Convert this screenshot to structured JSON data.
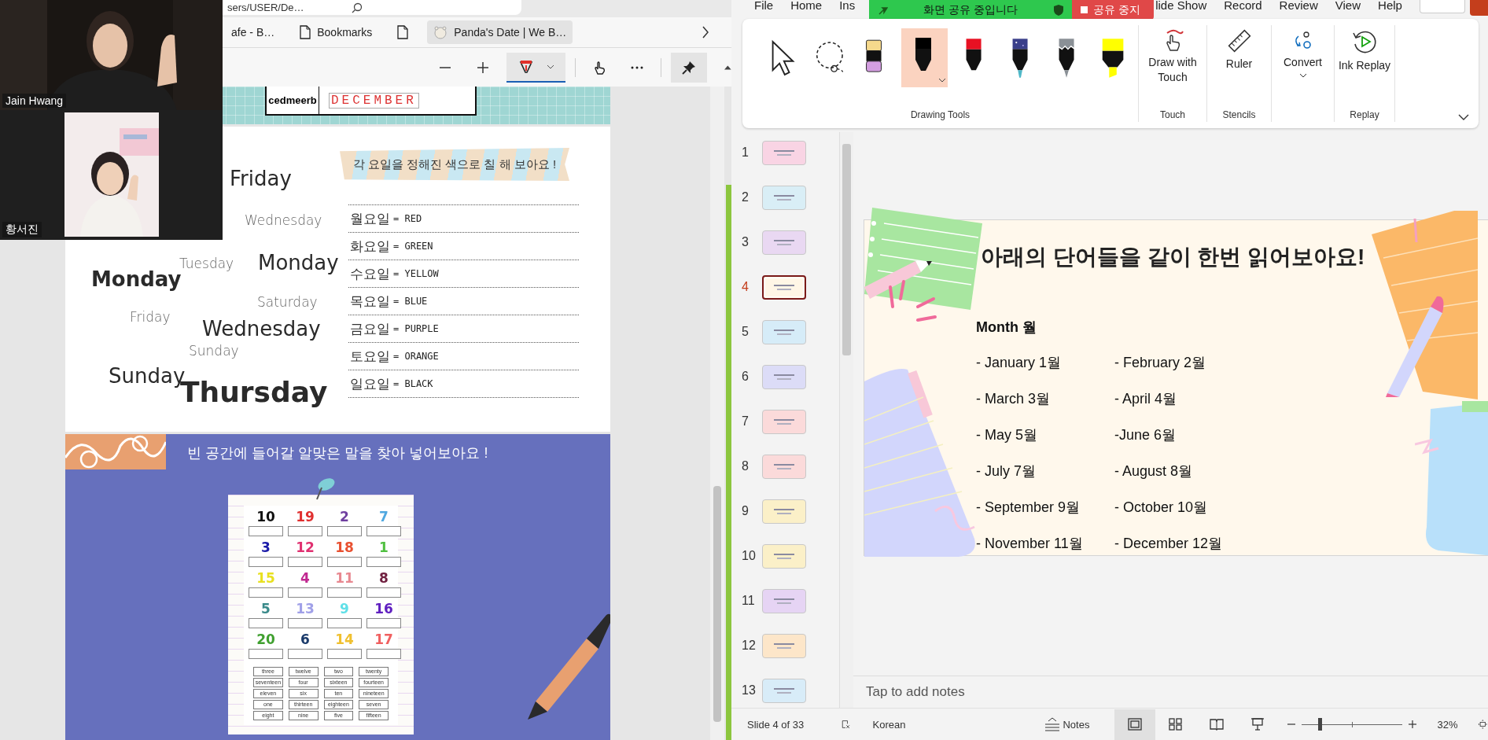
{
  "video_call": {
    "participants": [
      {
        "name": "Jain Hwang",
        "kind": "picture"
      },
      {
        "name": "황서진",
        "kind": "picture"
      }
    ]
  },
  "browser": {
    "address": "sers/USER/De…",
    "bookmarks": [
      {
        "kind": "text",
        "label": "afe - B…",
        "selected": false
      },
      {
        "kind": "page",
        "label": "Bookmarks",
        "selected": false
      },
      {
        "kind": "page-only",
        "selected": false
      },
      {
        "kind": "favicon",
        "label": "Panda's Date | We B…",
        "selected": true
      }
    ],
    "pdf_tools": [
      {
        "kind": "zoom-out",
        "selected": false
      },
      {
        "kind": "zoom-in",
        "selected": false
      },
      {
        "kind": "draw",
        "selected": true
      },
      {
        "kind": "touch",
        "selected": false
      },
      {
        "kind": "more",
        "selected": false
      },
      {
        "kind": "pin",
        "selected": true
      }
    ]
  },
  "worksheet": {
    "answer_row": {
      "scrambled": "cedmeerb",
      "answer": "DECEMBER"
    },
    "days_activity": {
      "banner": "각 요일을 정해진 색으로 칠 해 보아요 !",
      "word_cloud": [
        {
          "text": "Friday",
          "kind": "large"
        },
        {
          "text": "Wednesday",
          "kind": "small"
        },
        {
          "text": "Tuesday",
          "kind": "small"
        },
        {
          "text": "Monday",
          "kind": "large"
        },
        {
          "text": "Monday",
          "kind": "bold"
        },
        {
          "text": "Saturday",
          "kind": "small"
        },
        {
          "text": "Friday",
          "kind": "small"
        },
        {
          "text": "Wednesday",
          "kind": "large"
        },
        {
          "text": "Sunday",
          "kind": "small"
        },
        {
          "text": "Sunday",
          "kind": "large"
        },
        {
          "text": "Thursday",
          "kind": "huge"
        }
      ],
      "color_key": [
        {
          "day": "월요일",
          "value": "= RED"
        },
        {
          "day": "화요일",
          "value": "= GREEN"
        },
        {
          "day": "수요일",
          "value": "= YELLOW"
        },
        {
          "day": "목요일",
          "value": "= BLUE"
        },
        {
          "day": "금요일",
          "value": "= PURPLE"
        },
        {
          "day": "토요일",
          "value": "= ORANGE"
        },
        {
          "day": "일요일",
          "value": "= BLACK"
        }
      ]
    },
    "numbers_activity": {
      "instruction": "빈 공간에 들어갈 알맞은 말을 찾아 넣어보아요 !",
      "numbers": [
        {
          "text": "10",
          "color": "#111111"
        },
        {
          "text": "19",
          "color": "#e03030"
        },
        {
          "text": "2",
          "color": "#7040a0"
        },
        {
          "text": "7",
          "color": "#50a8e0"
        },
        {
          "text": "3",
          "color": "#1a1aa8"
        },
        {
          "text": "12",
          "color": "#e03070"
        },
        {
          "text": "18",
          "color": "#e85030"
        },
        {
          "text": "1",
          "color": "#50c040"
        },
        {
          "text": "15",
          "color": "#e8e020"
        },
        {
          "text": "4",
          "color": "#c02890"
        },
        {
          "text": "11",
          "color": "#e88890"
        },
        {
          "text": "8",
          "color": "#702040"
        },
        {
          "text": "5",
          "color": "#3a8a8a"
        },
        {
          "text": "13",
          "color": "#a0a0e8"
        },
        {
          "text": "9",
          "color": "#60e0e8"
        },
        {
          "text": "16",
          "color": "#6020c0"
        },
        {
          "text": "20",
          "color": "#40a030"
        },
        {
          "text": "6",
          "color": "#1a3a6a"
        },
        {
          "text": "14",
          "color": "#f0c030"
        },
        {
          "text": "17",
          "color": "#f06060"
        }
      ],
      "word_bank": [
        "three",
        "twelve",
        "two",
        "twenty",
        "seventeen",
        "four",
        "sixteen",
        "fourteen",
        "eleven",
        "six",
        "ten",
        "nineteen",
        "one",
        "thirteen",
        "eighteen",
        "seven",
        "eight",
        "nine",
        "five",
        "fifteen"
      ]
    }
  },
  "powerpoint": {
    "menu": [
      "File",
      "Home",
      "Ins",
      "lide Show",
      "Record",
      "Review",
      "View",
      "Help"
    ],
    "share_banner": {
      "status": "화면 공유 중입니다",
      "stop_button": "공유 중지"
    },
    "ribbon": {
      "drawing_tools": {
        "label": "Drawing Tools",
        "tools": [
          {
            "kind": "select",
            "selected": false
          },
          {
            "kind": "lasso",
            "selected": false
          },
          {
            "kind": "eraser",
            "selected": false
          },
          {
            "kind": "pen",
            "color": "#000000",
            "selected": true
          },
          {
            "kind": "pen",
            "color": "#e81123",
            "selected": false
          },
          {
            "kind": "galaxy",
            "selected": false
          },
          {
            "kind": "pencil",
            "selected": false
          },
          {
            "kind": "highlighter",
            "color": "#ffff00",
            "selected": false
          }
        ]
      },
      "groups": [
        {
          "label": "Touch",
          "button": {
            "kind": "touch",
            "label": "Draw with Touch"
          }
        },
        {
          "label": "Stencils",
          "button": {
            "kind": "ruler",
            "label": "Ruler"
          }
        },
        {
          "button": {
            "kind": "convert",
            "label": "Convert",
            "dropdown": true
          }
        },
        {
          "label": "Replay",
          "button": {
            "kind": "replay",
            "label": "Ink Replay"
          }
        }
      ]
    },
    "thumbnails": [
      {
        "number": "1",
        "color": "#f9d4e4",
        "selected": false
      },
      {
        "number": "2",
        "color": "#d9eef6",
        "selected": false
      },
      {
        "number": "3",
        "color": "#e9d8f2",
        "selected": false
      },
      {
        "number": "4",
        "color": "#fff6e6",
        "selected": true
      },
      {
        "number": "5",
        "color": "#d6ecf8",
        "selected": false
      },
      {
        "number": "6",
        "color": "#dcdcf7",
        "selected": false
      },
      {
        "number": "7",
        "color": "#fbdada",
        "selected": false
      },
      {
        "number": "8",
        "color": "#fbdada",
        "selected": false
      },
      {
        "number": "9",
        "color": "#fbf0c8",
        "selected": false
      },
      {
        "number": "10",
        "color": "#fbf0c8",
        "selected": false
      },
      {
        "number": "11",
        "color": "#e6d4f4",
        "selected": false
      },
      {
        "number": "12",
        "color": "#fde6c9",
        "selected": false
      },
      {
        "number": "13",
        "color": "#d8ecf8",
        "selected": false
      }
    ],
    "slide": {
      "title": "아래의 단어들을 같이 한번 읽어보아요!",
      "heading": "Month 월",
      "months": [
        {
          "left": "- January 1월",
          "right": "- February 2월"
        },
        {
          "left": "- March 3월",
          "right": "- April 4월"
        },
        {
          "left": "- May 5월",
          "right": "-June 6월"
        },
        {
          "left": "- July 7월",
          "right": "- August 8월"
        },
        {
          "left": "- September 9월",
          "right": "- October 10월"
        },
        {
          "left": "- November 11월",
          "right": "- December 12월"
        }
      ]
    },
    "notes": {
      "placeholder": "Tap to add notes"
    },
    "status_bar": {
      "slide_info": "Slide 4 of 33",
      "language": "Korean",
      "notes_button": "Notes",
      "views": [
        {
          "kind": "normal",
          "selected": true
        },
        {
          "kind": "sorter",
          "selected": false
        },
        {
          "kind": "reading",
          "selected": false
        },
        {
          "kind": "slideshow",
          "selected": false
        }
      ],
      "zoom": {
        "level": 0.16,
        "reading": "32%"
      }
    }
  }
}
